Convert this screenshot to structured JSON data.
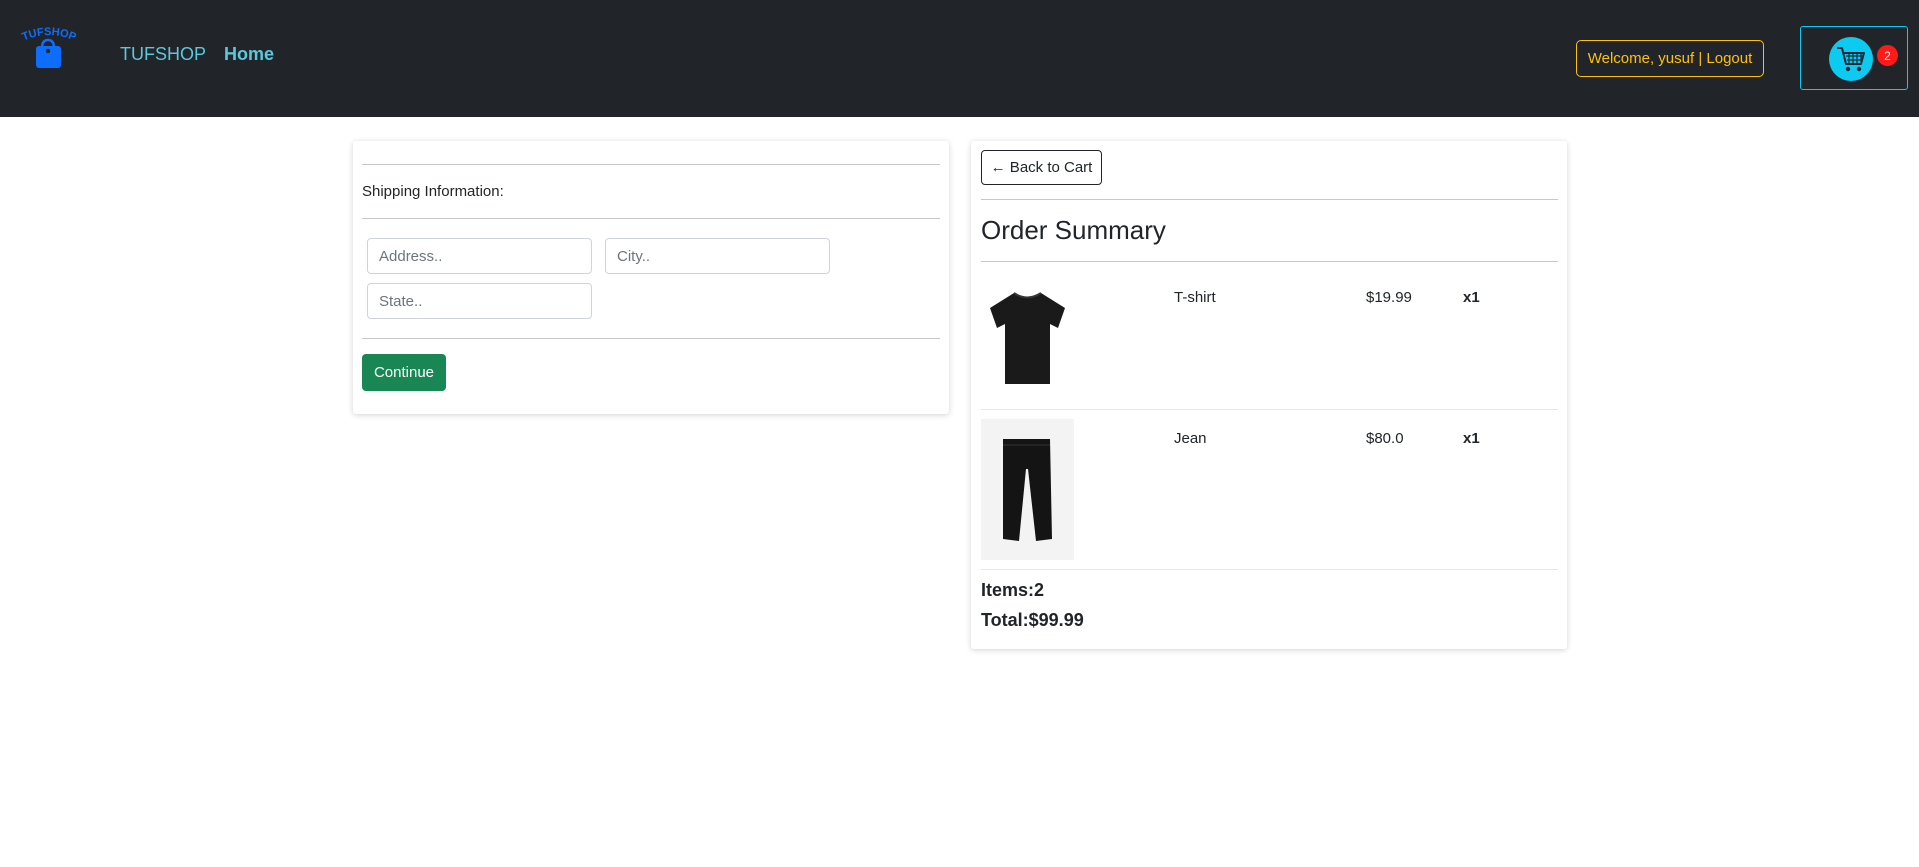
{
  "navbar": {
    "logo_text": "TUFSHOP",
    "brand": "TUFSHOP",
    "home_link": "Home",
    "welcome_button": "Welcome, yusuf | Logout",
    "cart_count": "2"
  },
  "shipping": {
    "label": "Shipping Information:",
    "address_placeholder": "Address..",
    "city_placeholder": "City..",
    "state_placeholder": "State..",
    "continue_label": "Continue"
  },
  "summary": {
    "back_label": "← Back to Cart",
    "title": "Order Summary",
    "items": [
      {
        "name": "T-shirt",
        "price": "$19.99",
        "qty": "x1",
        "image": "black-tshirt"
      },
      {
        "name": "Jean",
        "price": "$80.0",
        "qty": "x1",
        "image": "black-jeans"
      }
    ],
    "items_total": "Items:2",
    "total": "Total:$99.99"
  },
  "colors": {
    "navbar_bg": "#212529",
    "brand": "#5bc8dc",
    "warning": "#ffc107",
    "info": "#0dcaf0",
    "success": "#198754",
    "badge": "#ff1a1a"
  }
}
